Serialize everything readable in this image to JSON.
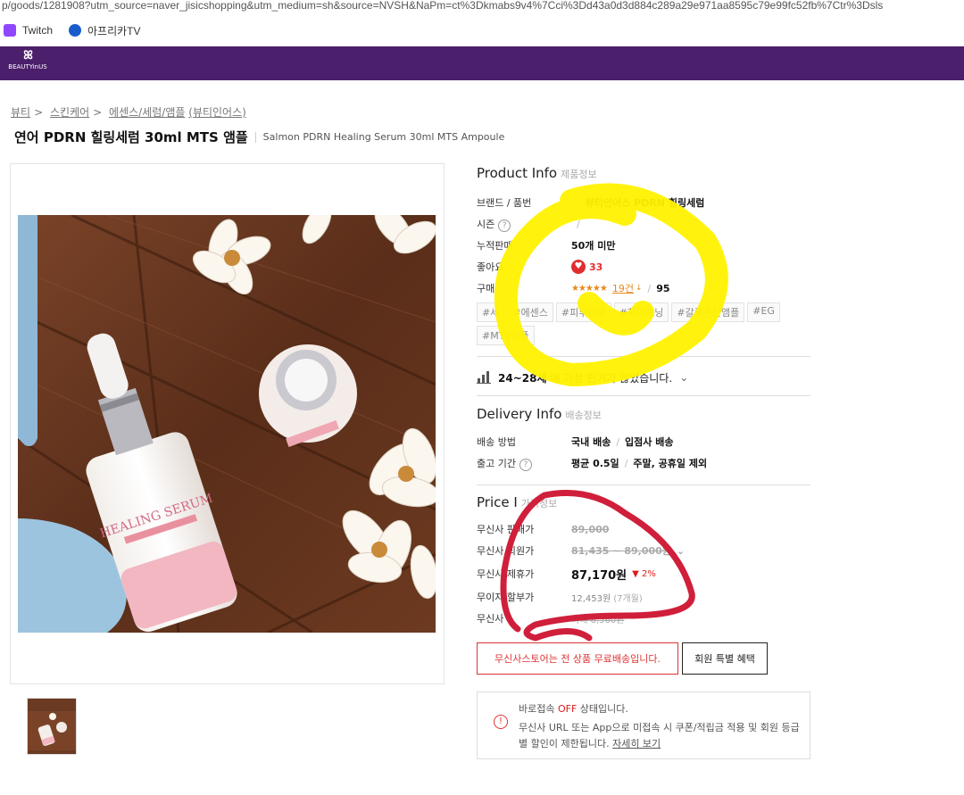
{
  "browser": {
    "url": "p/goods/1281908?utm_source=naver_jisicshopping&utm_medium=sh&source=NVSH&NaPm=ct%3Dkmabs9v4%7Cci%3Dd43a0d3d884c289a29e971aa8595c79e99fc52fb%7Ctr%3Dsls",
    "bookmarks": [
      {
        "label": "Twitch",
        "icon": "twitch-icon"
      },
      {
        "label": "아프리카TV",
        "icon": "afreecatv-icon"
      }
    ]
  },
  "brand": {
    "logo_text": "BEAUTYinUS"
  },
  "breadcrumb": [
    "뷰티",
    "스킨케어",
    "에센스/세럼/앰플",
    "(뷰티인어스)"
  ],
  "product": {
    "title_ko": "연어 PDRN 힐링세럼 30ml MTS 앰플",
    "title_en": "Salmon PDRN Healing Serum 30ml MTS Ampoule"
  },
  "product_info": {
    "title": "Product Info",
    "sub": "제품정보",
    "brand_label": "브랜드 / 품번",
    "brand_value": "뷰티인어스 PDRN 힐링세럼",
    "season_label": "시즌",
    "sales_label": "누적판매",
    "sales_value": "50개 미만",
    "likes_label": "좋아요",
    "likes_value": "33",
    "purchase_label": "구매",
    "stars": "★★★★★",
    "reviews": "19건",
    "satisfaction": "95",
    "tags": [
      "#세",
      "#에센스",
      "#피부탄력",
      "#화이트닝",
      "#갈루론산앰플",
      "#EG",
      "#MTS앰플"
    ],
    "age_text": "24~28세",
    "age_suffix": "에 가장 인기가 많았습니다."
  },
  "delivery": {
    "title": "Delivery Info",
    "sub": "배송정보",
    "method_label": "배송 방법",
    "method_value": "국내 배송",
    "method_value2": "입점사 배송",
    "ship_label": "출고 기간",
    "ship_value": "평균 0.5일",
    "ship_value2": "주말, 공휴일 제외"
  },
  "price": {
    "title": "Price I",
    "sub": "가격정보",
    "rows": [
      {
        "label": "무신사 판매가",
        "value": "89,000"
      },
      {
        "label": "무신사 회원가",
        "value": "81,435 ~ 89,000원"
      },
      {
        "label": "무신사 제휴가",
        "value": "87,170원",
        "discount": "2%"
      },
      {
        "label": "무이자 할부가",
        "value": "12,453원",
        "note": "(7개월)"
      },
      {
        "label": "무신사",
        "value": "최대 8,560원"
      }
    ],
    "free_ship_btn": "무신사스토어는 전 상품 무료배송입니다.",
    "member_btn": "회원 특별 혜택"
  },
  "notice": {
    "line1_pre": "바로접속 ",
    "line1_off": "OFF",
    "line1_post": " 상태입니다.",
    "line2": "무신사 URL 또는 App으로 미접속 시 쿠폰/적립금 적용 및 회원 등급별 할인이 제한됩니다.",
    "link": "자세히 보기"
  },
  "colors": {
    "brand": "#4b1f6b",
    "accent_red": "#e01c1c",
    "highlight_yellow": "#fff200",
    "scribble_red": "#d01f3b"
  }
}
